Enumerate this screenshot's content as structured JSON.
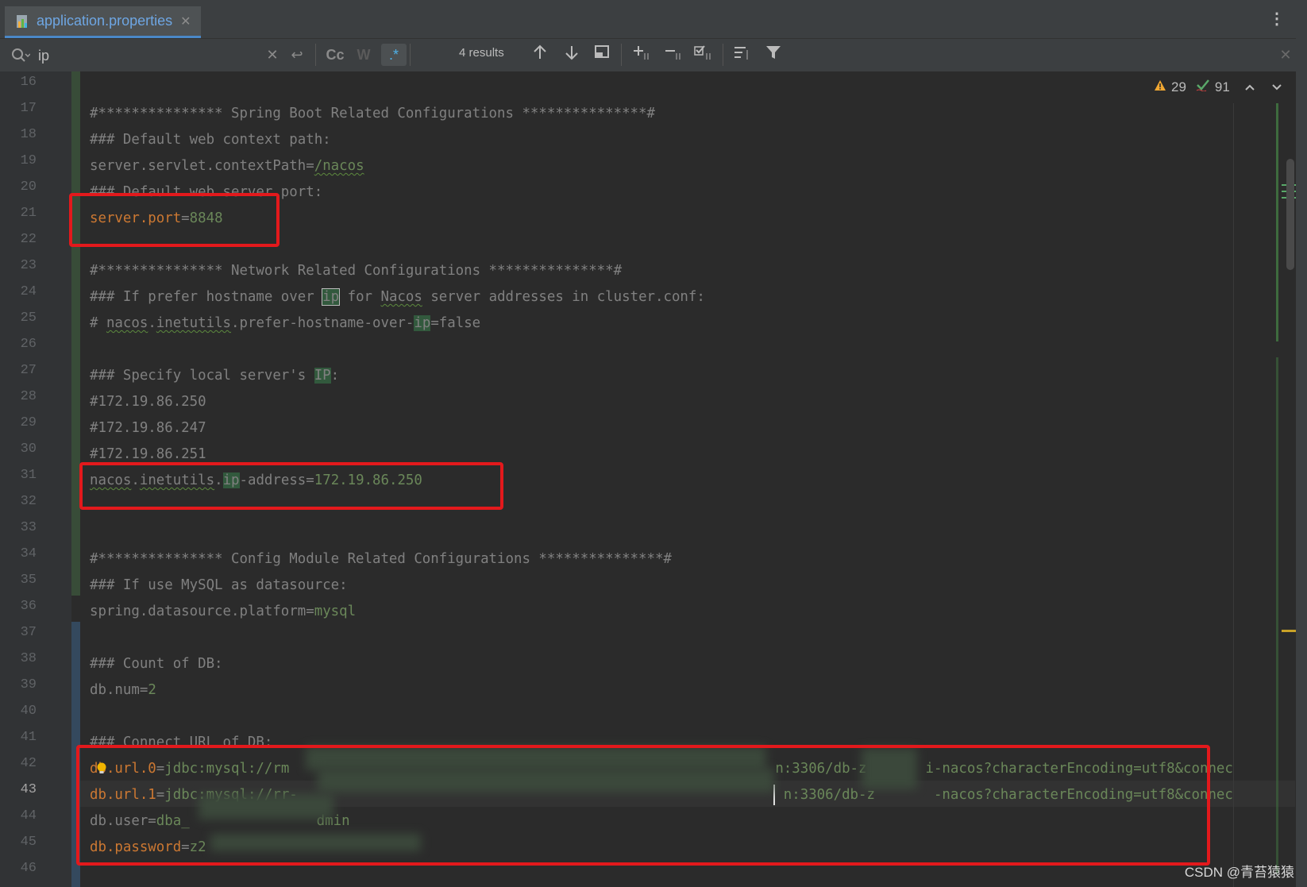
{
  "tab": {
    "label": "application.properties"
  },
  "find": {
    "query": "ip",
    "results": "4 results",
    "case_label": "Cc",
    "word_label": "W",
    "regex_label": ".*"
  },
  "inspection": {
    "warnings": "29",
    "ok": "91"
  },
  "gutter": {
    "line_numbers": [
      "16",
      "17",
      "18",
      "19",
      "20",
      "21",
      "22",
      "23",
      "24",
      "25",
      "26",
      "27",
      "28",
      "29",
      "30",
      "31",
      "32",
      "33",
      "34",
      "35",
      "36",
      "37",
      "38",
      "39",
      "40",
      "41",
      "42",
      "43",
      "44",
      "45",
      "46"
    ],
    "current_line": "43"
  },
  "lines": {
    "l17": "#*************** Spring Boot Related Configurations ***************#",
    "l18": "### Default web context path:",
    "l19_key": "server.servlet.contextPath",
    "l19_val": "/nacos",
    "l20": "### Default web server port:",
    "l21_key": "server.port",
    "l21_val": "8848",
    "l23": "#*************** Network Related Configurations ***************#",
    "l24_a": "### If prefer hostname over ",
    "l24_ip": "ip",
    "l24_b": " for ",
    "l24_nacos": "Nacos",
    "l24_c": " server addresses in cluster.conf:",
    "l25_a": "# ",
    "l25_b": "nacos",
    "l25_c": ".",
    "l25_d": "inetutils",
    "l25_e": ".prefer-hostname-over-",
    "l25_ip": "ip",
    "l25_f": "=false",
    "l27_a": "### Specify local server's ",
    "l27_ip": "IP",
    "l27_b": ":",
    "l28": "#172.19.86.250",
    "l29": "#172.19.86.247",
    "l30": "#172.19.86.251",
    "l31_a": "nacos",
    "l31_b": ".",
    "l31_c": "inetutils",
    "l31_d": ".",
    "l31_ip": "ip",
    "l31_e": "-address",
    "l31_f": "=",
    "l31_val": "172.19.86.250",
    "l34": "#*************** Config Module Related Configurations ***************#",
    "l35": "### If use MySQL as datasource:",
    "l36_key": "spring.datasource.platform",
    "l36_val": "mysql",
    "l38": "### Count of DB:",
    "l39_key": "db.num",
    "l39_val": "2",
    "l41": "### Connect URL of DB:",
    "l42_key": "db.url.0",
    "l42_val_a": "jdbc:mysql://rm",
    "l42_val_b": "n:3306/db-z",
    "l42_val_c": "i-nacos?characterEncoding=utf8&connec",
    "l43_key": "db.url.1",
    "l43_val_a": "jdbc:mysql://rr-",
    "l43_val_b": "n:3306/db-z",
    "l43_val_c": "-nacos?characterEncoding=utf8&connec",
    "l44_key": "db.user",
    "l44_val_a": "dba_",
    "l44_val_b": "dmin",
    "l45_key": "db.password",
    "l45_val": "z2"
  },
  "watermark": "CSDN @青苔猿猿",
  "colors": {
    "background": "#2b2b2b",
    "key": "#cc7832",
    "value": "#6a8759",
    "comment": "#808080",
    "highlight_box": "#e3191c",
    "tab_accent": "#4a88c7"
  }
}
